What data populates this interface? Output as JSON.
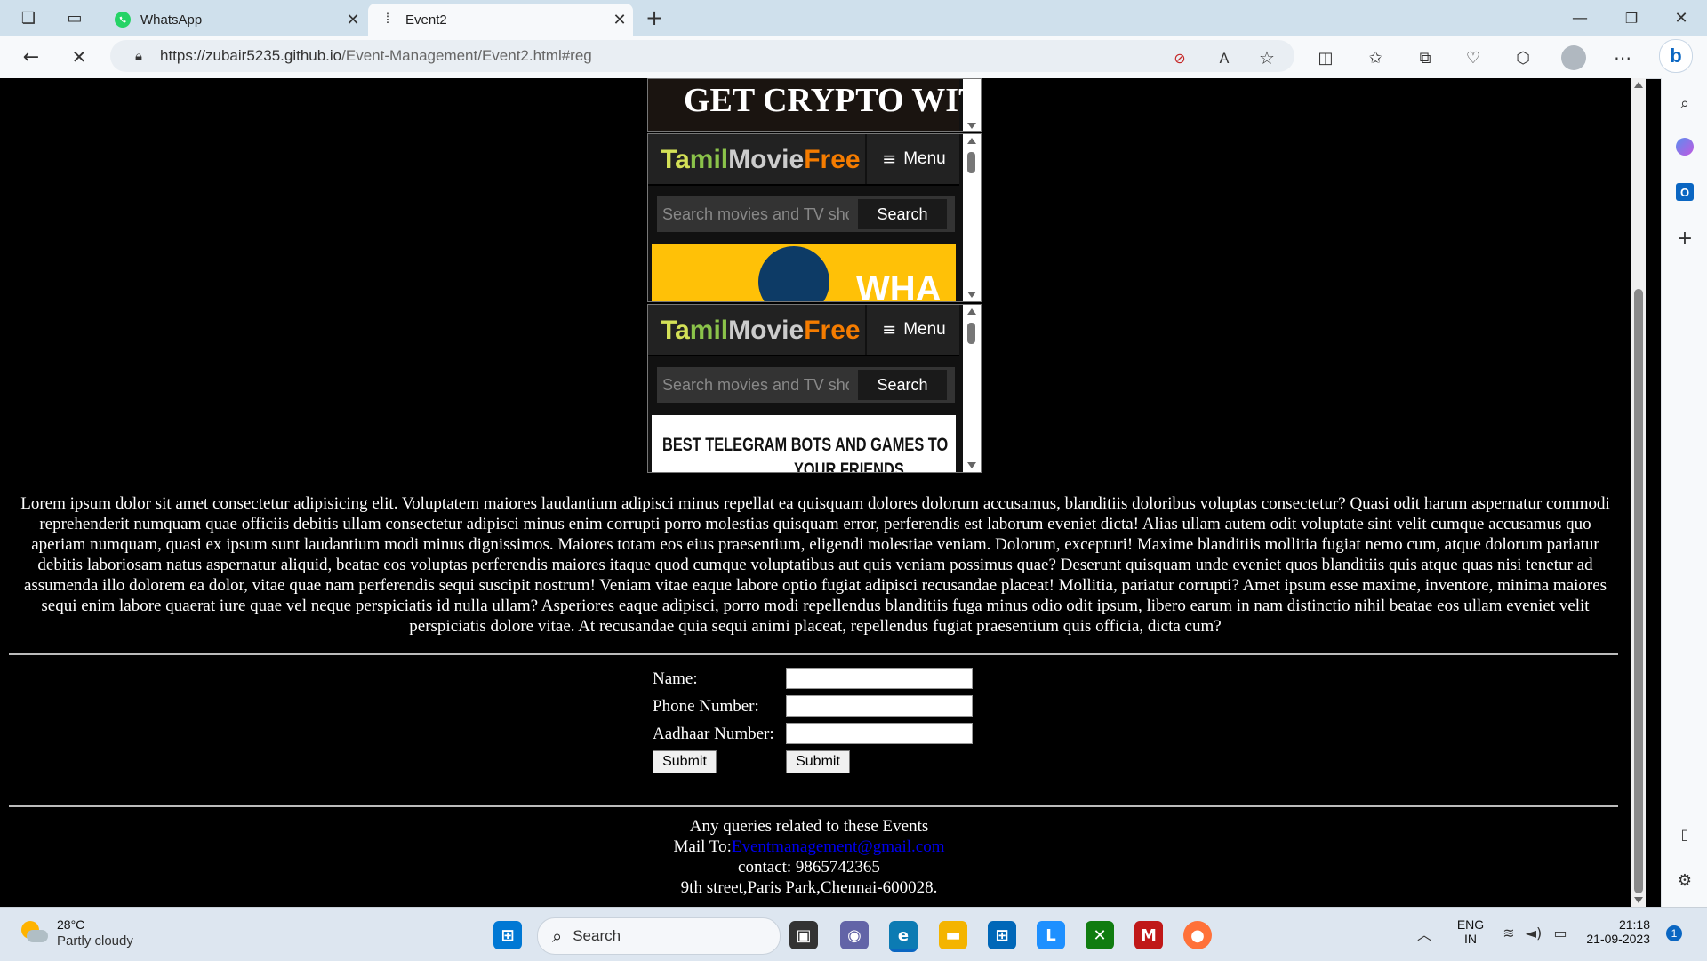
{
  "browser": {
    "tabs": [
      {
        "title": "WhatsApp",
        "active": false
      },
      {
        "title": "Event2",
        "active": true
      }
    ],
    "url_host": "https://zubair5235.github.io",
    "url_path": "/Event-Management/Event2.html#reg"
  },
  "ads": {
    "top_banner_text": "GET CRYPTO WIT",
    "tmf_blocks": [
      {
        "logo": {
          "part1": "Ta",
          "part2": "mil",
          "part3": "Movie",
          "part4": "Free"
        },
        "menu_label": "Menu",
        "search_placeholder": "Search movies and TV sho",
        "search_button": "Search",
        "banner_text": "WHA"
      },
      {
        "logo": {
          "part1": "Ta",
          "part2": "mil",
          "part3": "Movie",
          "part4": "Free"
        },
        "menu_label": "Menu",
        "search_placeholder": "Search movies and TV sho",
        "search_button": "Search",
        "banner_text": "BEST TELEGRAM BOTS AND GAMES TO",
        "banner_text_2": "YOUR FRIENDS"
      }
    ]
  },
  "content": {
    "lorem": "Lorem ipsum dolor sit amet consectetur adipisicing elit. Voluptatem maiores laudantium adipisci minus repellat ea quisquam dolores dolorum accusamus, blanditiis doloribus voluptas consectetur? Quasi odit harum aspernatur commodi reprehenderit numquam quae officiis debitis ullam consectetur adipisci minus enim corrupti porro molestias quisquam error, perferendis est laborum eveniet dicta! Alias ullam autem odit voluptate sint velit cumque accusamus quo aperiam numquam, quasi ex ipsum sunt laudantium modi minus dignissimos. Maiores totam eos eius praesentium, eligendi molestiae veniam. Dolorum, excepturi! Maxime blanditiis mollitia fugiat nemo cum, atque dolorum pariatur debitis laboriosam natus aspernatur aliquid, beatae eos voluptas perferendis maiores itaque quod cumque voluptatibus aut quis veniam possimus quae? Deserunt quisquam unde eveniet quos blanditiis quis atque quas nisi tenetur ad assumenda illo dolorem ea dolor, vitae quae nam perferendis sequi suscipit nostrum! Veniam vitae eaque labore optio fugiat adipisci recusandae placeat! Mollitia, pariatur corrupti? Amet ipsum esse maxime, inventore, minima maiores sequi enim labore quaerat iure quae vel neque perspiciatis id nulla ullam? Asperiores eaque adipisci, porro modi repellendus blanditiis fuga minus odio odit ipsum, libero earum in nam distinctio nihil beatae eos ullam eveniet velit perspiciatis dolore vitae. At recusandae quia sequi animi placeat, repellendus fugiat praesentium quis officia, dicta cum?"
  },
  "form": {
    "name_label": "Name:",
    "phone_label": "Phone Number:",
    "aadhaar_label": "Aadhaar Number:",
    "name_value": "",
    "phone_value": "",
    "aadhaar_value": "",
    "submit_1": "Submit",
    "submit_2": "Submit"
  },
  "footer": {
    "line1": "Any queries related to these Events",
    "mail_prefix": "Mail To:",
    "mail_link": "Eventmanagement@gmail.com",
    "contact": "contact: 9865742365",
    "address": "9th street,Paris Park,Chennai-600028."
  },
  "taskbar": {
    "weather_temp": "28°C",
    "weather_desc": "Partly cloudy",
    "search_label": "Search",
    "lang_1": "ENG",
    "lang_2": "IN",
    "time": "21:18",
    "date": "21-09-2023",
    "notification_count": "1"
  },
  "colors": {
    "tmf_yellow": "#d4e157",
    "tmf_orange": "#f57c00",
    "tmf_grey": "#cccccc",
    "ad_yellow": "#ffc107",
    "link_blue": "#0000ee",
    "edge_blue": "#0a66c2"
  }
}
